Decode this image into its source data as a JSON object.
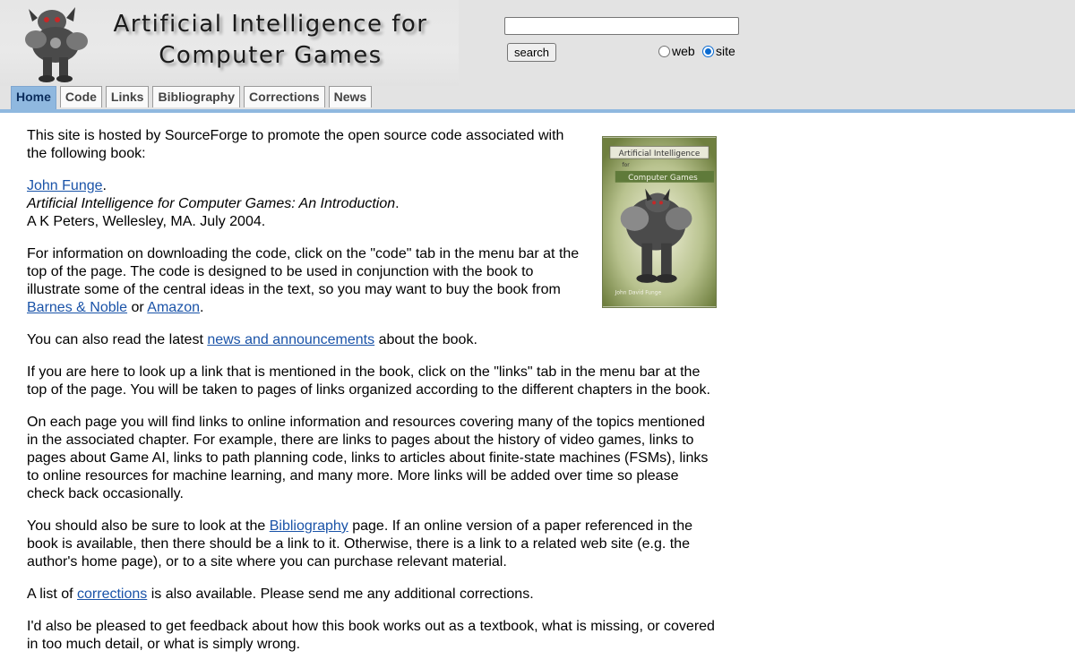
{
  "header": {
    "title_line1": "Artificial Intelligence for",
    "title_line2": "Computer Games",
    "logo_icon": "robot-mascot-icon"
  },
  "search": {
    "input_value": "",
    "button_label": "search",
    "options": [
      "web",
      "site"
    ],
    "selected": "site"
  },
  "nav": {
    "tabs": [
      {
        "label": "Home",
        "active": true
      },
      {
        "label": "Code",
        "active": false
      },
      {
        "label": "Links",
        "active": false
      },
      {
        "label": "Bibliography",
        "active": false
      },
      {
        "label": "Corrections",
        "active": false
      },
      {
        "label": "News",
        "active": false
      }
    ]
  },
  "book_cover": {
    "title_top": "Artificial Intelligence",
    "title_for": "for",
    "title_bottom": "Computer Games",
    "author": "John David Funge"
  },
  "content": {
    "intro": "This site is hosted by SourceForge to promote the open source code associated with the following book:",
    "author_link": "John Funge",
    "author_suffix": ".",
    "book_title": "Artificial Intelligence for Computer Games: An Introduction",
    "book_title_suffix": ".",
    "publisher": "A K Peters, Wellesley, MA. July 2004.",
    "p_download_1": "For information on downloading the code, click on the \"code\" tab in the menu bar at the top of the page. The code is designed to be used in conjunction with the book to illustrate some of the central ideas in the text, so you may want to buy the book from ",
    "link_bn": "Barnes & Noble",
    "p_download_2": " or ",
    "link_amazon": "Amazon",
    "p_download_3": ".",
    "p_news_1": "You can also read the latest ",
    "link_news": "news and announcements",
    "p_news_2": " about the book.",
    "p_links": "If you are here to look up a link that is mentioned in the book, click on the \"links\" tab in the menu bar at the top of the page. You will be taken to pages of links organized according to the different chapters in the book.",
    "p_each": "On each page you will find links to online information and resources covering many of the topics mentioned in the associated chapter. For example, there are links to pages about the history of video games, links to pages about Game AI, links to path planning code, links to articles about finite-state machines (FSMs), links to online resources for machine learning, and many more. More links will be added over time so please check back occasionally.",
    "p_bib_1": "You should also be sure to look at the ",
    "link_bib": "Bibliography",
    "p_bib_2": " page. If an online version of a paper referenced in the book is available, then there should be a link to it. Otherwise, there is a link to a related web site (e.g. the author's home page), or to a site where you can purchase relevant material.",
    "p_corr_1": "A list of ",
    "link_corr": "corrections",
    "p_corr_2": " is also available. Please send me any additional corrections.",
    "p_feedback": "I'd also be pleased to get feedback about how this book works out as a textbook, what is missing, or covered in too much detail, or what is simply wrong."
  },
  "colors": {
    "header_bg": "#e3e3e3",
    "tab_active_bg": "#8fb8df",
    "link": "#1a53a8",
    "cover_green": "#5f7a3a"
  }
}
